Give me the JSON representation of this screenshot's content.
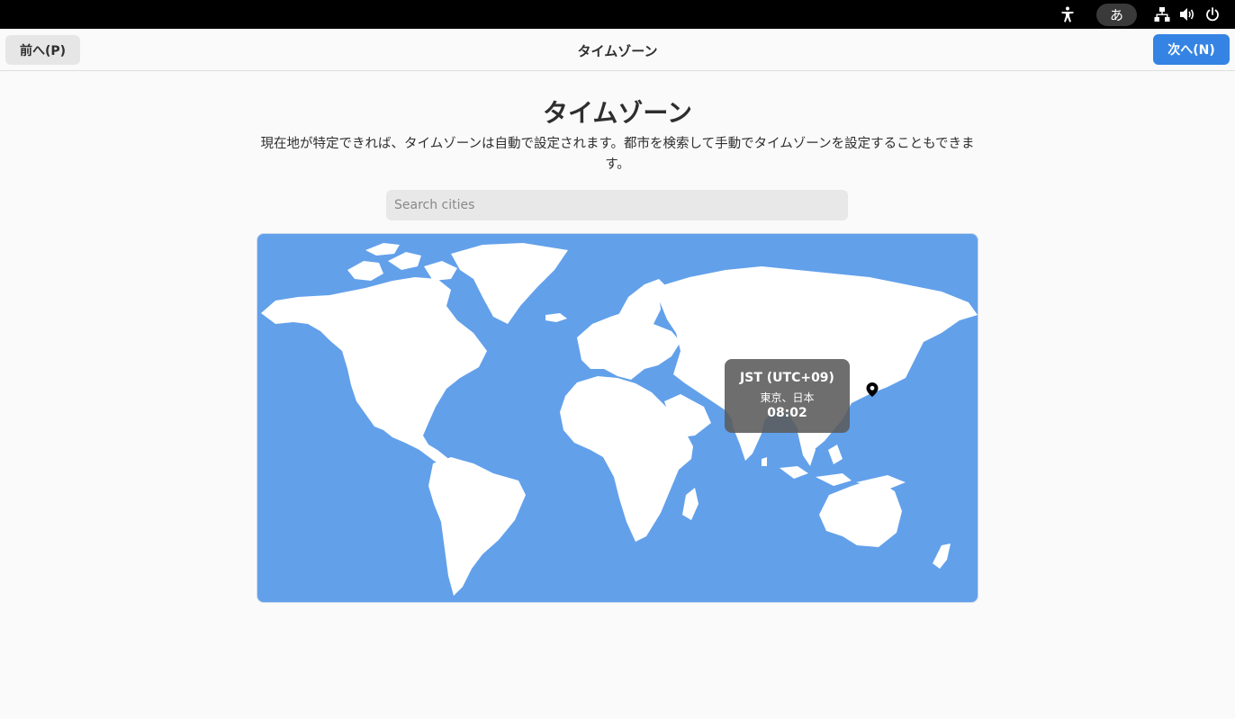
{
  "topbar": {
    "accessibility_icon": "accessibility-icon",
    "input_method": "あ",
    "network_icon": "network-wired-icon",
    "volume_icon": "volume-icon",
    "power_icon": "power-icon"
  },
  "header": {
    "back_label": "前へ(P)",
    "title": "タイムゾーン",
    "next_label": "次へ(N)"
  },
  "main": {
    "title": "タイムゾーン",
    "description": "現在地が特定できれば、タイムゾーンは自動で設定されます。都市を検索して手動でタイムゾーンを設定することもできます。",
    "search_placeholder": "Search cities",
    "search_value": ""
  },
  "map": {
    "tooltip": {
      "abbreviation": "JST (UTC+09)",
      "city": "東京、日本",
      "time": "08:02"
    },
    "pin_icon": "location-pin-icon"
  },
  "colors": {
    "accent": "#3584e4",
    "ocean": "#62a0ea",
    "land": "#ffffff",
    "topbar": "#000000"
  }
}
